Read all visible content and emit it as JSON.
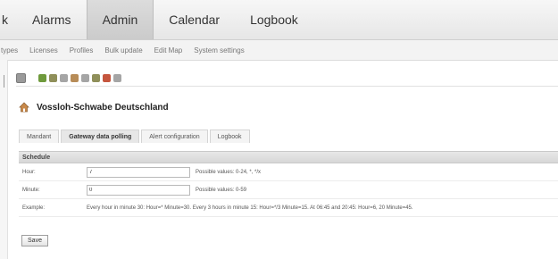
{
  "topnav": {
    "tabs": [
      {
        "label": "k"
      },
      {
        "label": "Alarms"
      },
      {
        "label": "Admin"
      },
      {
        "label": "Calendar"
      },
      {
        "label": "Logbook"
      }
    ],
    "active": "Admin"
  },
  "subnav": {
    "items": [
      "types",
      "Licenses",
      "Profiles",
      "Bulk update",
      "Edit Map",
      "System settings"
    ]
  },
  "toolbar": {
    "icons": [
      "list-icon",
      "transfer-icon",
      "tool-icon",
      "device-icon",
      "home-icon",
      "link-icon",
      "lock-icon",
      "user-icon",
      "gauge-icon"
    ]
  },
  "page": {
    "title": "Vossloh-Schwabe Deutschland"
  },
  "tabs": [
    {
      "label": "Mandant"
    },
    {
      "label": "Gateway data polling"
    },
    {
      "label": "Alert configuration"
    },
    {
      "label": "Logbook"
    }
  ],
  "active_tab": "Gateway data polling",
  "schedule": {
    "heading": "Schedule",
    "hour": {
      "label": "Hour:",
      "value": "7",
      "hint": "Possible values: 0-24, *, */x"
    },
    "minute": {
      "label": "Minute:",
      "value": "0",
      "hint": "Possible values: 0-59"
    },
    "example": {
      "label": "Example:",
      "text": "Every hour in minute 30: Hour=* Minute=30. Every 3 hours in minute 15: Hour=*/3 Minute=15. At 06:45 and 20:45: Hour=6, 20 Minute=45."
    }
  },
  "actions": {
    "save_label": "Save"
  }
}
